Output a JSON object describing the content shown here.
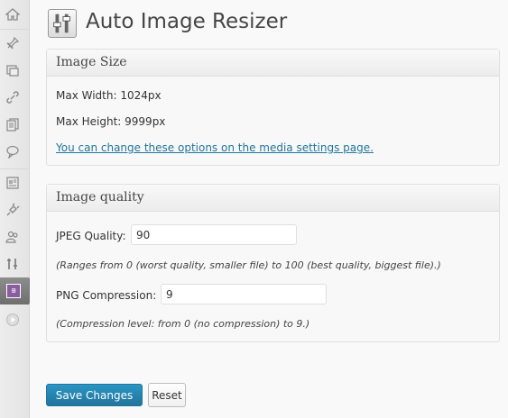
{
  "page": {
    "title": "Auto Image Resizer"
  },
  "image_size": {
    "heading": "Image Size",
    "max_width": "Max Width: 1024px",
    "max_height": "Max Height: 9999px",
    "settings_link": "You can change these options on the media settings page."
  },
  "image_quality": {
    "heading": "Image quality",
    "jpeg_label": "JPEG Quality:",
    "jpeg_value": "90",
    "jpeg_help": "(Ranges from 0 (worst quality, smaller file) to 100 (best quality, biggest file).)",
    "png_label": "PNG Compression:",
    "png_value": "9",
    "png_help": "(Compression level: from 0 (no compression) to 9.)"
  },
  "actions": {
    "save_label": "Save Changes",
    "reset_label": "Reset"
  },
  "sidebar": {
    "icons": [
      "dashboard-icon",
      "posts-icon",
      "media-icon",
      "links-icon",
      "pages-icon",
      "comments-icon",
      "appearance-icon",
      "plugins-icon",
      "users-icon",
      "tools-icon",
      "plugin-settings-icon",
      "collapse-icon"
    ]
  },
  "colors": {
    "primary_button": "#21759b",
    "link": "#21759b",
    "active_menu_icon": "#8a5ca0"
  }
}
